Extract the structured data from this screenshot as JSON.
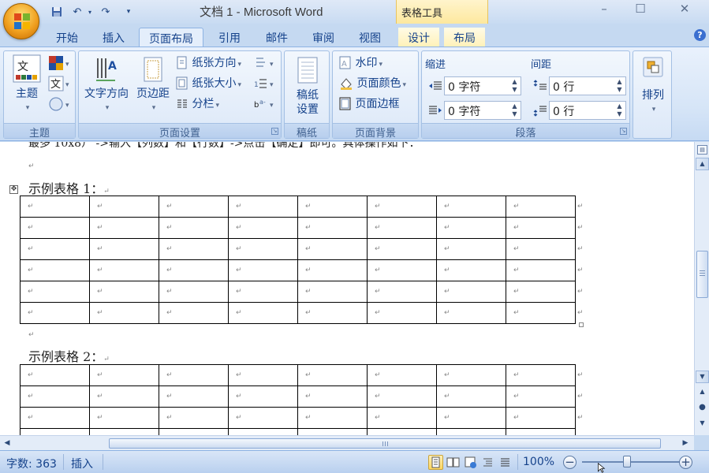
{
  "window": {
    "title": "文档 1 - Microsoft Word",
    "context_tab_group": "表格工具"
  },
  "quick_access": {
    "save_icon": "save-icon",
    "undo_icon": "undo-icon",
    "redo_icon": "redo-icon",
    "customize_icon": "customize-icon"
  },
  "tabs": [
    "开始",
    "插入",
    "页面布局",
    "引用",
    "邮件",
    "审阅",
    "视图",
    "设计",
    "布局"
  ],
  "active_tab": "页面布局",
  "ribbon": {
    "theme_group": {
      "label": "主题",
      "theme_button": "主题"
    },
    "page_setup": {
      "label": "页面设置",
      "text_direction": "文字方向",
      "margins": "页边距",
      "orientation": "纸张方向",
      "size": "纸张大小",
      "columns": "分栏"
    },
    "manuscript": {
      "label": "稿纸",
      "button_line1": "稿纸",
      "button_line2": "设置"
    },
    "page_background": {
      "label": "页面背景",
      "watermark": "水印",
      "page_color": "页面颜色",
      "page_borders": "页面边框"
    },
    "paragraph": {
      "label": "段落",
      "indent_title": "缩进",
      "spacing_title": "间距",
      "indent_left": "0 字符",
      "indent_right": "0 字符",
      "spacing_before": "0 行",
      "spacing_after": "0 行"
    },
    "arrange": {
      "label": "排列"
    }
  },
  "document": {
    "top_line": "最多 10x8） ->输入【列数】和【行数】->点击【确定】即可。具体操作如下：",
    "table1_caption": "示例表格 1：",
    "table2_caption": "示例表格 2：",
    "paragraph_mark": "↵",
    "table1": {
      "rows": 6,
      "cols": 8
    },
    "table2": {
      "rows_visible": 4,
      "cols": 8
    }
  },
  "statusbar": {
    "word_count": "字数: 363",
    "mode": "插入",
    "zoom": "100%",
    "zoom_minus": "−",
    "zoom_plus": "+"
  }
}
